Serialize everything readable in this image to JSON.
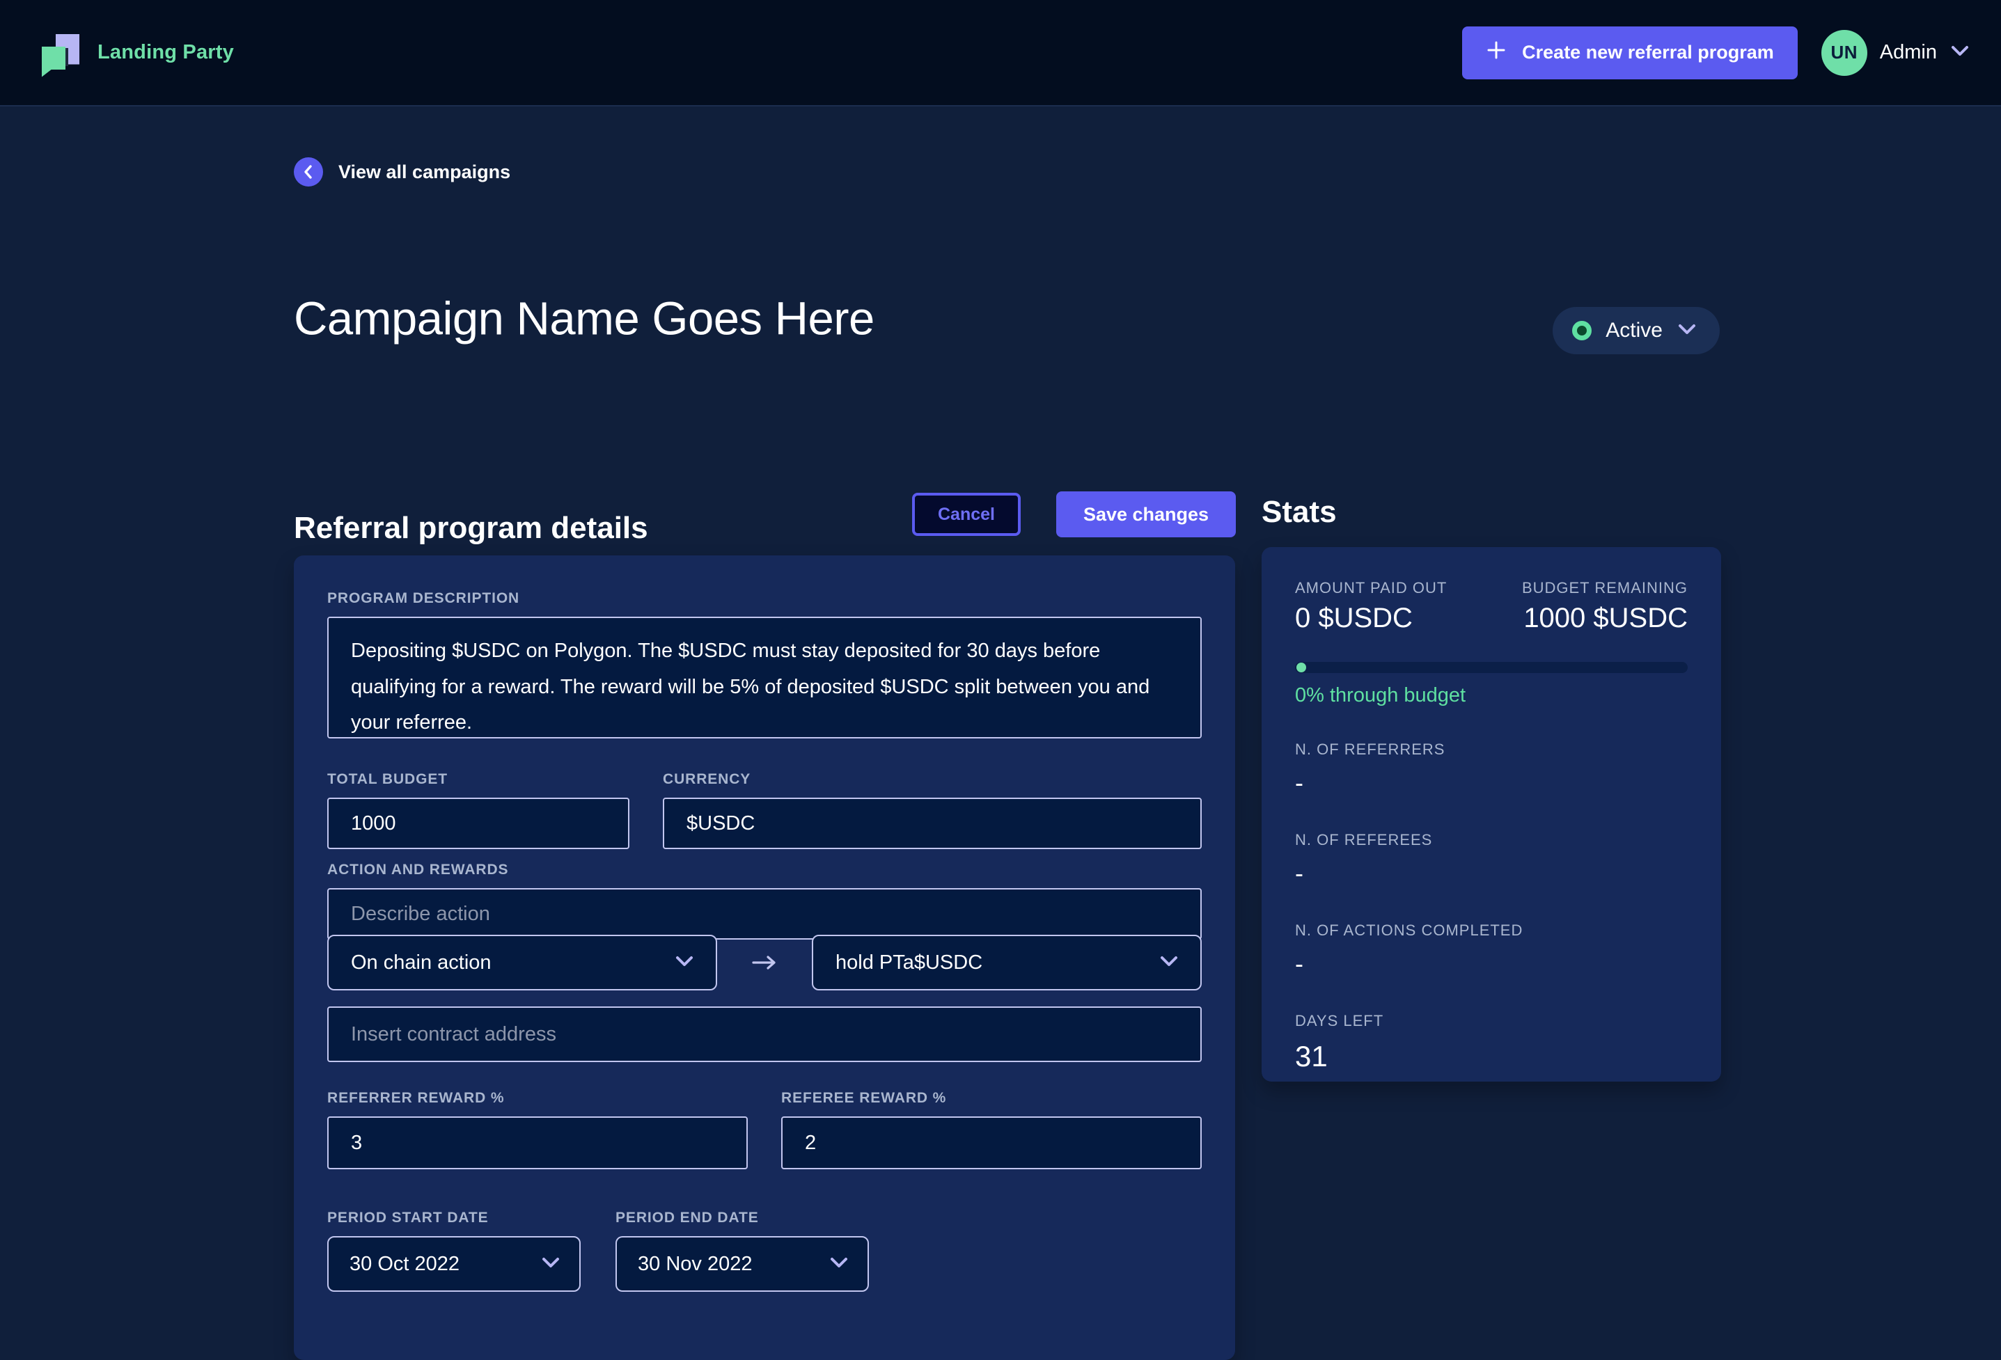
{
  "brand": {
    "name": "Landing Party",
    "logo_icon": "chat-bubbles-logo"
  },
  "topbar": {
    "create_button": {
      "label": "Create new referral program",
      "icon": "plus-icon"
    },
    "user": {
      "initials": "UN",
      "name": "Admin",
      "chevron_icon": "chevron-down-icon"
    }
  },
  "breadcrumb": {
    "label": "View all campaigns",
    "icon": "chevron-left-icon"
  },
  "page": {
    "title": "Campaign Name Goes Here",
    "status": {
      "label": "Active",
      "icon": "status-ring-icon",
      "chevron_icon": "chevron-down-icon"
    }
  },
  "details": {
    "section_title": "Referral program details",
    "cancel_label": "Cancel",
    "save_label": "Save changes",
    "program_description": {
      "label": "Program description",
      "value": "Depositing $USDC on Polygon. The $USDC must stay deposited for 30 days before qualifying for a reward. The reward will be 5% of deposited $USDC split between you and your referree."
    },
    "total_budget": {
      "label": "Total budget",
      "value": "1000"
    },
    "currency": {
      "label": "Currency",
      "value": "$USDC"
    },
    "action_and_rewards": {
      "label": "Action and rewards",
      "describe_action_placeholder": "Describe action",
      "action_type": "On chain action",
      "arrow_icon": "arrow-right-icon",
      "action_target": "hold PTa$USDC",
      "contract_address_placeholder": "Insert contract address"
    },
    "referrer_reward": {
      "label": "Referrer reward %",
      "value": "3"
    },
    "referee_reward": {
      "label": "Referee reward %",
      "value": "2"
    },
    "period_start": {
      "label": "Period start date",
      "value": "30 Oct 2022"
    },
    "period_end": {
      "label": "Period end date",
      "value": "30 Nov 2022"
    }
  },
  "stats": {
    "title": "Stats",
    "amount_paid_out": {
      "label": "Amount paid out",
      "value": "0 $USDC"
    },
    "budget_remaining": {
      "label": "Budget remaining",
      "value": "1000 $USDC"
    },
    "progress": {
      "percent": 0,
      "note": "0% through budget"
    },
    "items": [
      {
        "label": "N. of referrers",
        "value": "-"
      },
      {
        "label": "N. of referees",
        "value": "-"
      },
      {
        "label": "N. of actions completed",
        "value": "-"
      }
    ],
    "days_left": {
      "label": "Days left",
      "value": "31"
    }
  },
  "colors": {
    "page_bg": "#101f3b",
    "topbar_bg": "#030d1f",
    "card_bg": "#16295a",
    "input_bg": "#041a40",
    "accent_purple": "#5b5bf0",
    "accent_green": "#6fdfa8",
    "border_lavender": "#c2c6ef"
  }
}
